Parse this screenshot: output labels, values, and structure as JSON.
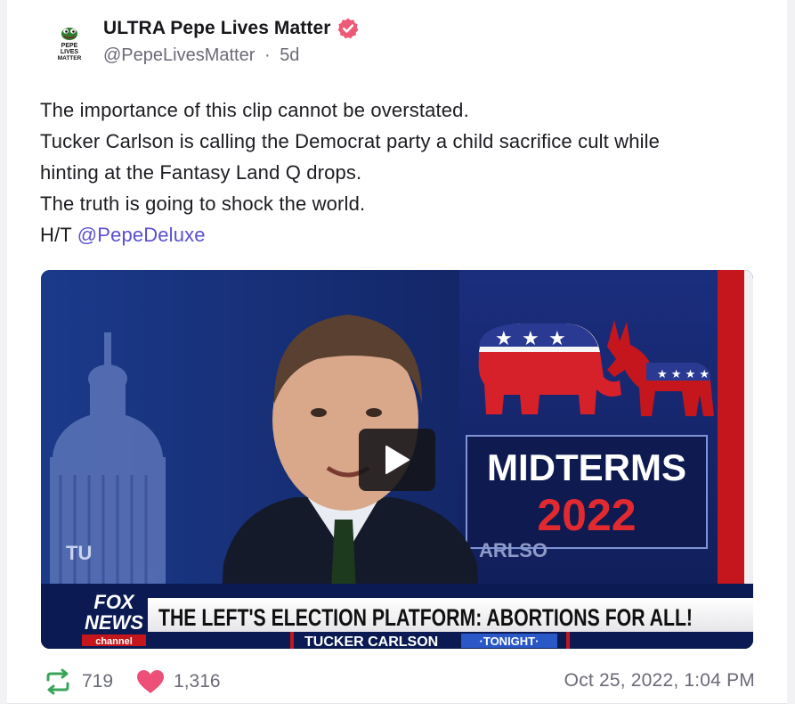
{
  "post": {
    "author": {
      "display_name": "ULTRA Pepe Lives Matter",
      "handle": "@PepeLivesMatter",
      "separator": "·",
      "age": "5d",
      "avatar_text": [
        "PEPE",
        "LIVES",
        "MATTER"
      ],
      "verified_color": "#ec5a78"
    },
    "text_lines": [
      "The importance of this clip cannot be overstated.",
      "Tucker Carlson is calling the Democrat party a child sacrifice cult while",
      "hinting at the Fantasy Land Q drops.",
      "The truth is going to shock the world."
    ],
    "ht_prefix": "H/T ",
    "mention": "@PepeDeluxe",
    "media": {
      "type": "video",
      "graphic_title": "MIDTERMS",
      "graphic_year": "2022",
      "bg_partial_text_left": "TU",
      "bg_partial_text_right": "ARLSO",
      "network_logo": [
        "FOX",
        "NEWS",
        "channel"
      ],
      "chyron": "THE LEFT'S ELECTION PLATFORM: ABORTIONS FOR ALL!",
      "subchyron_show": "TUCKER CARLSON",
      "subchyron_tag": "·TONIGHT·"
    },
    "stats": {
      "reposts": "719",
      "likes": "1,316"
    },
    "timestamp": "Oct 25, 2022, 1:04 PM"
  },
  "colors": {
    "mention": "#5a4fd0",
    "repost_icon": "#3aa55a",
    "like_icon": "#ec4f78",
    "muted_text": "#6b6b78"
  }
}
